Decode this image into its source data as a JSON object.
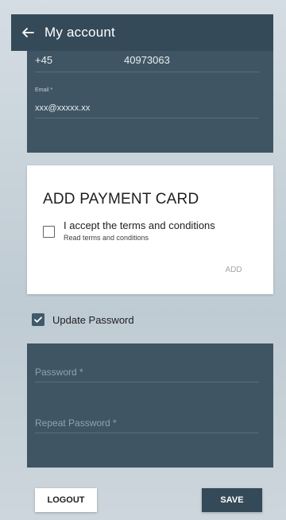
{
  "header": {
    "title": "My account",
    "back_icon": "arrow-left-icon"
  },
  "contact": {
    "phone_prefix": "+45",
    "phone_number": "40973063",
    "email_label": "Email *",
    "email_value": "xxx@xxxxx.xx"
  },
  "payment": {
    "title": "ADD PAYMENT CARD",
    "terms_label": "I accept the terms and conditions",
    "terms_link": "Read terms and conditions",
    "terms_checked": false,
    "add_label": "ADD"
  },
  "password_toggle": {
    "label": "Update Password",
    "checked": true
  },
  "password_form": {
    "password_placeholder": "Password *",
    "repeat_placeholder": "Repeat Password *"
  },
  "actions": {
    "logout_label": "LOGOUT",
    "save_label": "SAVE"
  },
  "colors": {
    "primary": "#354a58",
    "card_dark": "#3f5563",
    "checkbox": "#3f5a6a"
  }
}
